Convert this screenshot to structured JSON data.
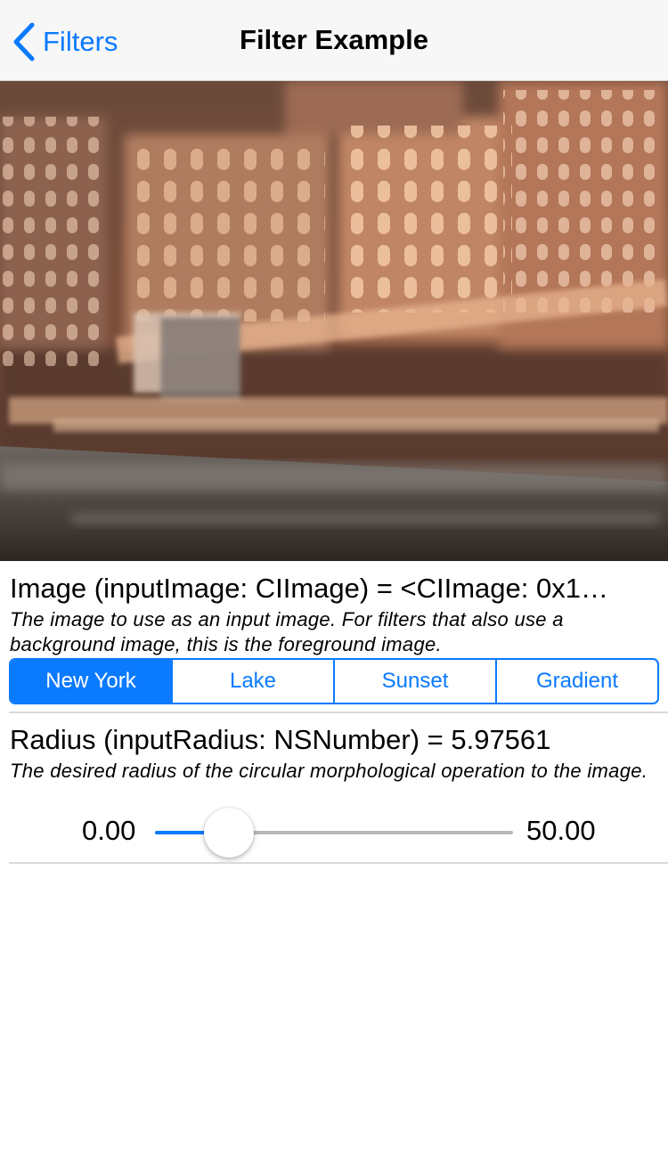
{
  "navbar": {
    "back_label": "Filters",
    "title": "Filter Example",
    "accent_color": "#0a7aff"
  },
  "preview": {
    "icon": "filtered-photo"
  },
  "image_param": {
    "title": "Image (inputImage: CIImage) = <CIImage: 0x1…",
    "description": "The image to use as an input image. For filters that also use a background image, this is the foreground image.",
    "options": [
      "New York",
      "Lake",
      "Sunset",
      "Gradient"
    ],
    "selected": "New York"
  },
  "radius_param": {
    "title": "Radius (inputRadius: NSNumber) = 5.97561",
    "description": "The desired radius of the circular morphological operation to the image.",
    "min_label": "0.00",
    "max_label": "50.00",
    "min": 0,
    "max": 50,
    "value": 5.97561
  }
}
